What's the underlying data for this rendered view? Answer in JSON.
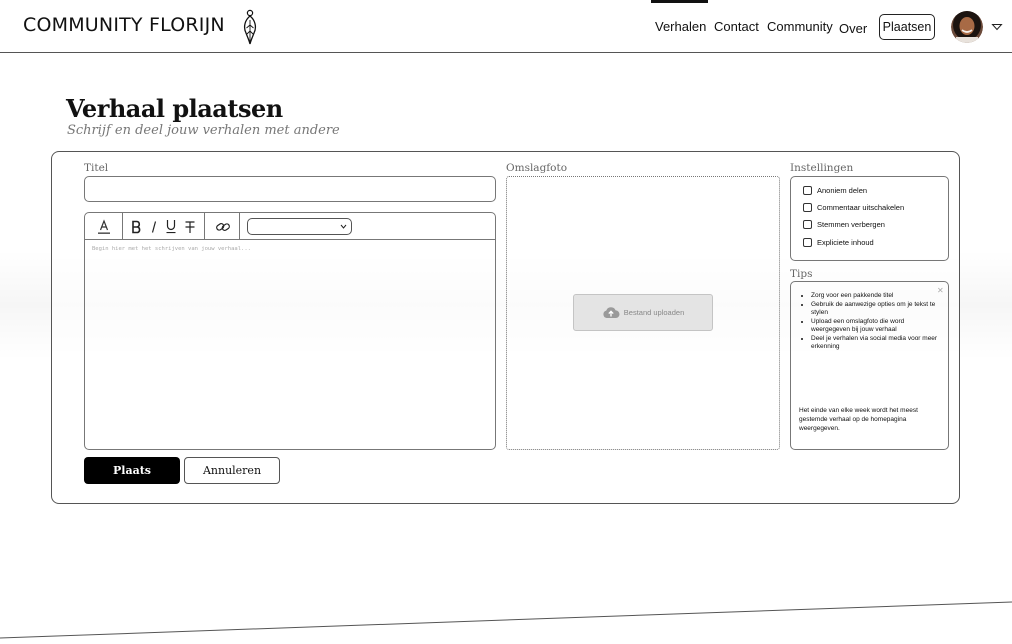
{
  "brand": {
    "name": "COMMUNITY FLORIJN",
    "logo_icon": "feather-logo-icon"
  },
  "nav": {
    "items": [
      {
        "label": "Verhalen",
        "active": true
      },
      {
        "label": "Contact"
      },
      {
        "label": "Community"
      },
      {
        "label": "Over"
      }
    ],
    "post_button": "Plaatsen",
    "menu_icon": "chevron-down-icon"
  },
  "page": {
    "title": "Verhaal plaatsen",
    "subtitle": "Schrijf en deel jouw verhalen met andere"
  },
  "form": {
    "title_label": "Titel",
    "title_value": "",
    "editor": {
      "placeholder": "Begin hier met het schrijven van jouw verhaal...",
      "toolbar": [
        "text-color-icon",
        "bold-icon",
        "italic-icon",
        "underline-icon",
        "strikethrough-icon",
        "link-icon"
      ],
      "select_value": ""
    },
    "cover_label": "Omslagfoto",
    "upload_label": "Bestand uploaden",
    "settings_label": "Instellingen",
    "settings": [
      {
        "label": "Anoniem delen",
        "checked": false
      },
      {
        "label": "Commentaar uitschakelen",
        "checked": false
      },
      {
        "label": "Stemmen verbergen",
        "checked": false
      },
      {
        "label": "Expliciete inhoud",
        "checked": false
      }
    ],
    "tips_label": "Tips",
    "tips": [
      "Zorg voor een pakkende titel",
      "Gebruik de aanwezige opties om je tekst te stylen",
      "Upload een omslagfoto die word weergegeven bij jouw verhaal",
      "Deel je verhalen via social media voor meer erkenning"
    ],
    "tips_note": "Het einde van elke week wordt het meest gestemde verhaal op de homepagina weergegeven.",
    "submit_label": "Plaats",
    "cancel_label": "Annuleren"
  },
  "colors": {
    "primary": "#000000",
    "border": "#555555",
    "muted": "#777777",
    "upload_bg": "#e4e4e4"
  }
}
